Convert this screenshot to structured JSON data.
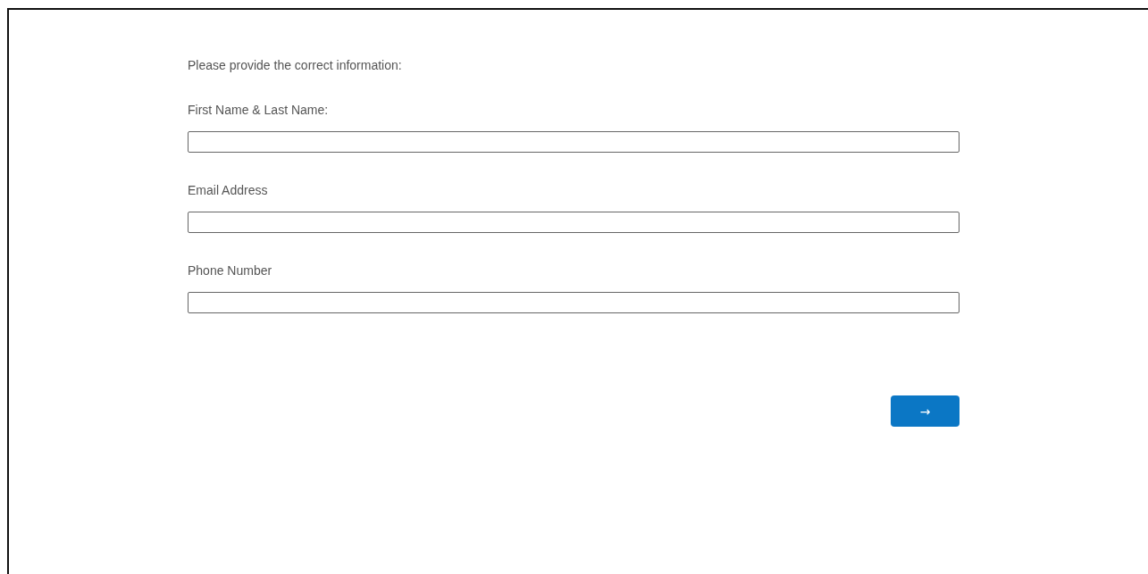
{
  "intro": "Please provide the correct information:",
  "fields": [
    {
      "label": "First Name & Last Name:"
    },
    {
      "label": "Email Address"
    },
    {
      "label": "Phone Number"
    }
  ],
  "submit_button": {
    "label": "→"
  }
}
